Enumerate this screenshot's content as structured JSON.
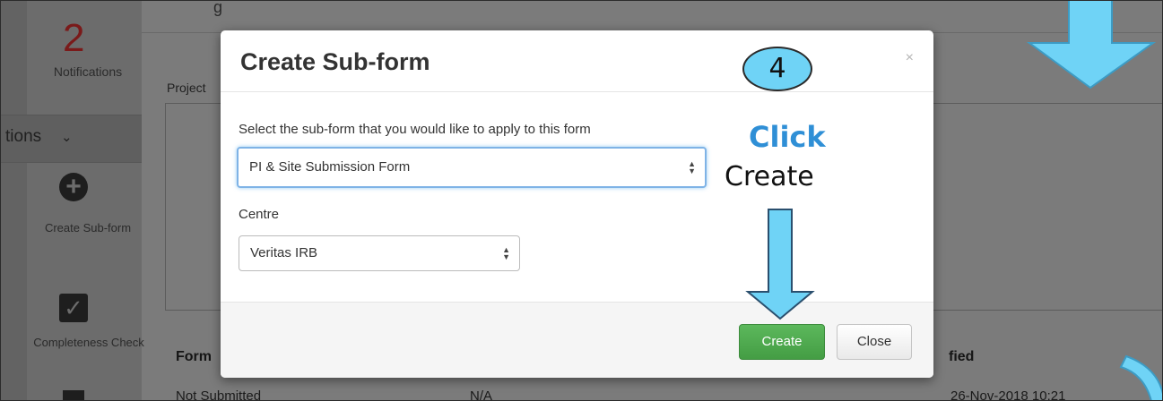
{
  "background": {
    "heading_fragment": "g",
    "notifications_count": "2",
    "notifications_label": "Notifications",
    "actions_label": "tions",
    "actions_chevron": "⌄",
    "create_subform_label": "Create Sub-form",
    "completeness_check_label": "Completeness Check",
    "project_label": "Project",
    "table_headers": {
      "form": "Form",
      "modified": "fied"
    },
    "table_row": {
      "status": "Not Submitted",
      "na": "N/A",
      "date": "26-Nov-2018 10:21"
    }
  },
  "modal": {
    "title": "Create Sub-form",
    "close_glyph": "×",
    "subform_prompt": "Select the sub-form that you would like to apply to this form",
    "subform_value": "PI & Site Submission Form",
    "centre_label": "Centre",
    "centre_value": "Veritas IRB",
    "create_button": "Create",
    "close_button": "Close"
  },
  "annotation": {
    "step_number": "4",
    "click_text": "Click",
    "create_text": "Create",
    "highlight_color": "#6fd3f6",
    "click_color": "#2f8fd6"
  },
  "icons": {
    "plus": "plus-circle-icon",
    "check": "checkbox-icon",
    "print": "print-icon",
    "select_caret": "up-down-caret-icon"
  }
}
